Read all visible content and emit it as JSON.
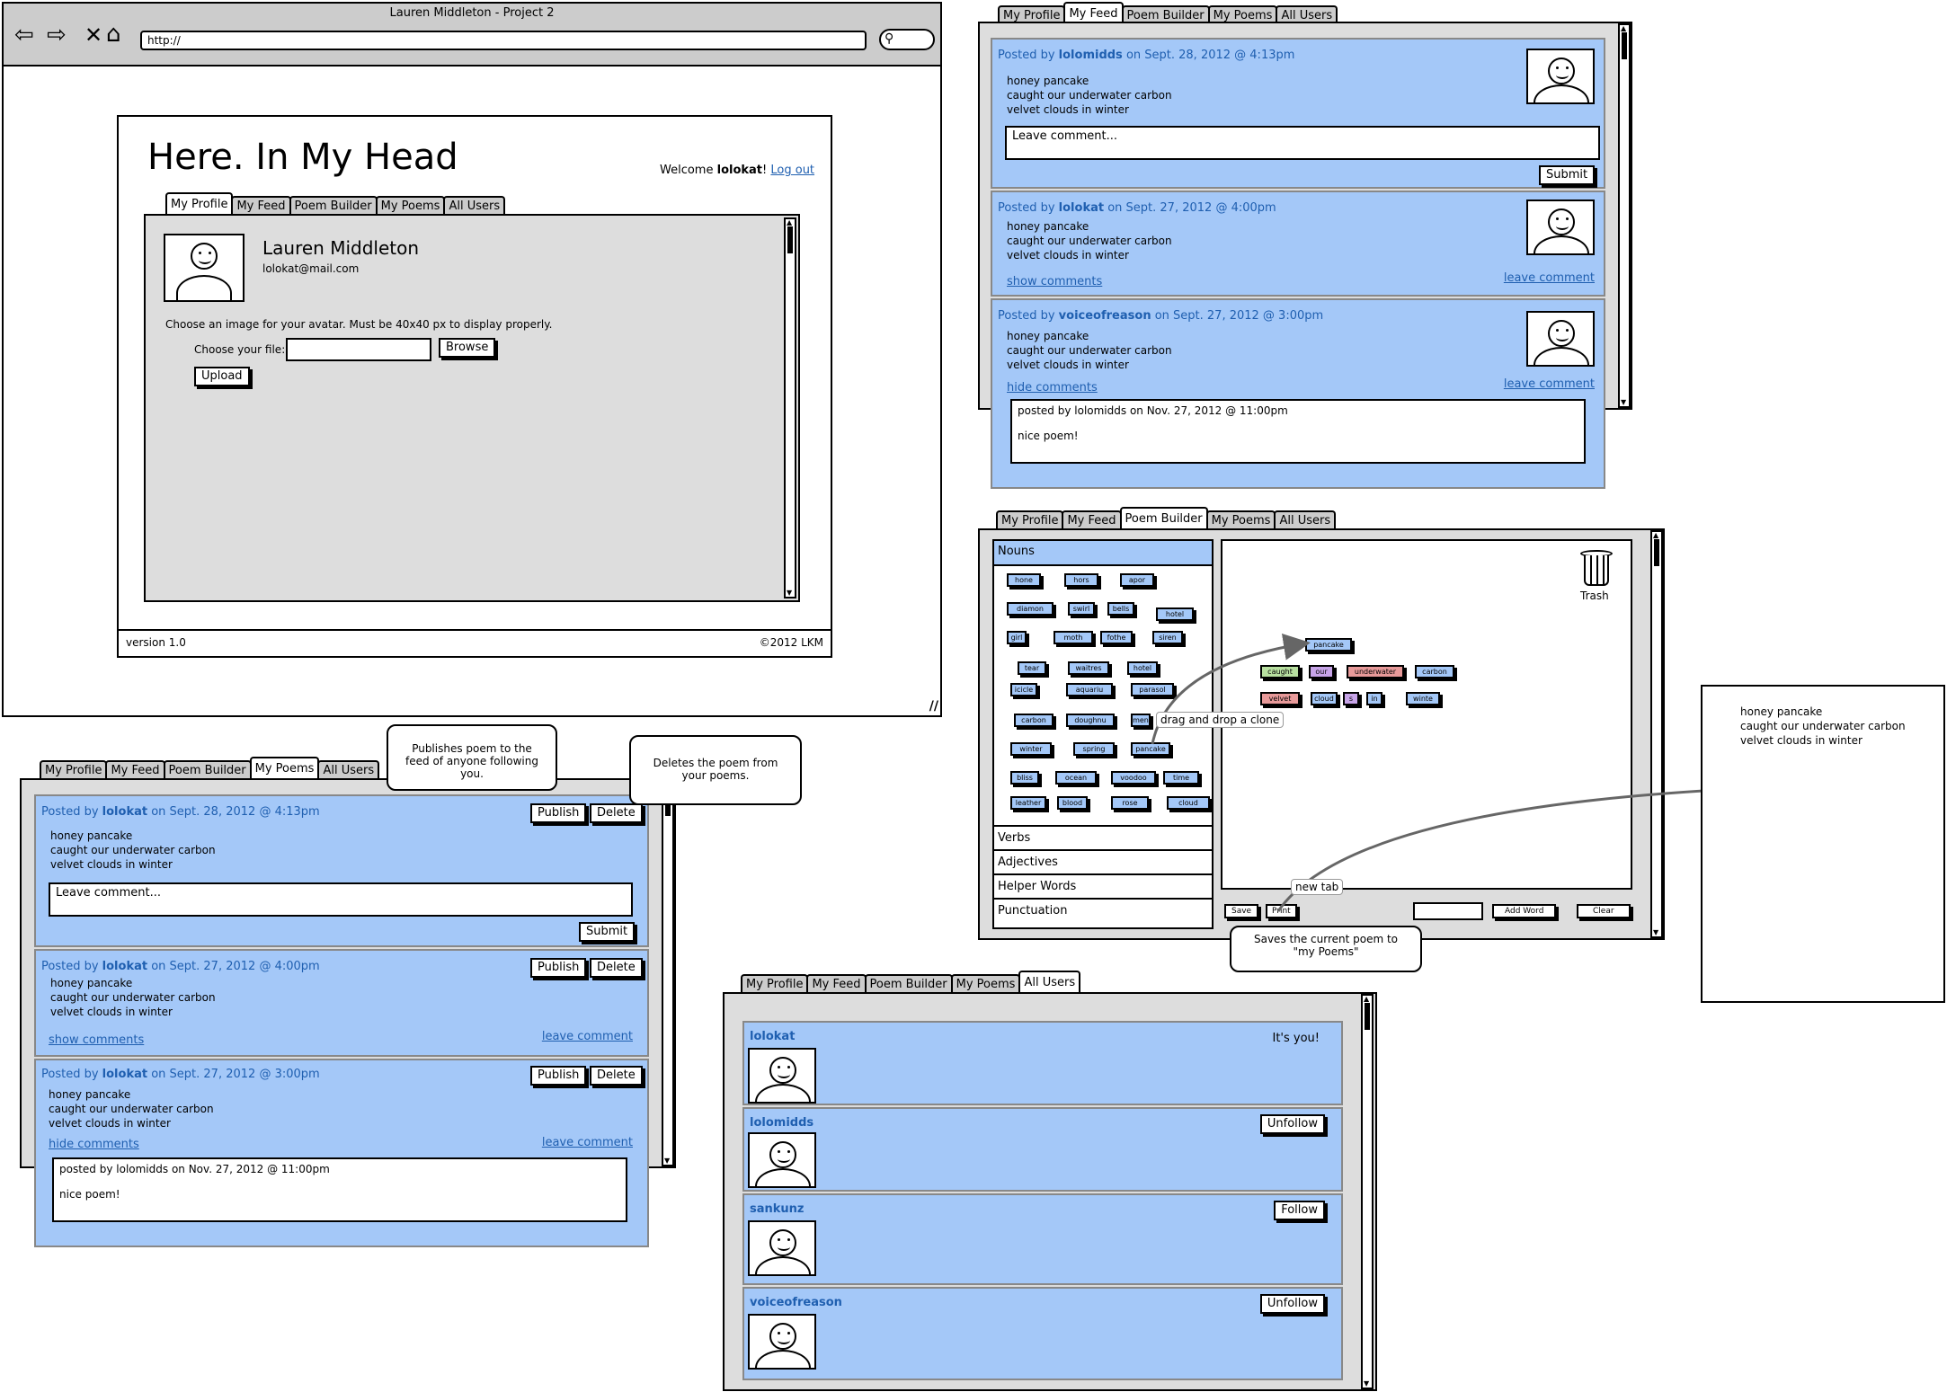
{
  "browser": {
    "title": "Lauren Middleton - Project 2",
    "url": "http://"
  },
  "profile": {
    "site_title": "Here. In My Head",
    "welcome_prefix": "Welcome ",
    "welcome_user": "lolokat",
    "welcome_suffix": "!",
    "logout_label": "Log out",
    "tabs": [
      "My Profile",
      "My Feed",
      "Poem Builder",
      "My Poems",
      "All Users"
    ],
    "name": "Lauren Middleton",
    "email": "lolokat@mail.com",
    "avatar_instructions": "Choose an image for your avatar. Must be 40x40 px to display properly.",
    "choose_file_label": "Choose your file:",
    "browse_label": "Browse",
    "upload_label": "Upload",
    "version": "version 1.0",
    "copyright": "©2012 LKM"
  },
  "poem_lines": [
    "honey pancake",
    "caught our underwater carbon",
    "velvet clouds in winter"
  ],
  "feed": {
    "tabs": [
      "My Profile",
      "My Feed",
      "Poem Builder",
      "My Poems",
      "All Users"
    ],
    "posts": [
      {
        "prefix": "Posted by ",
        "user": "lolomidds",
        "date": " on Sept. 28, 2012 @ 4:13pm"
      },
      {
        "prefix": "Posted by ",
        "user": "lolokat",
        "date": " on Sept. 27, 2012 @ 4:00pm"
      },
      {
        "prefix": "Posted by ",
        "user": "voiceofreason",
        "date": " on Sept. 27, 2012 @ 3:00pm"
      }
    ],
    "comment_placeholder": "Leave comment...",
    "submit_label": "Submit",
    "show_comments": "show comments",
    "hide_comments": "hide comments",
    "leave_comment": "leave comment",
    "comment_header": "posted by lolomidds on Nov. 27, 2012 @ 11:00pm",
    "comment_text": "nice poem!"
  },
  "mypoems": {
    "tabs": [
      "My Profile",
      "My Feed",
      "Poem Builder",
      "My Poems",
      "All Users"
    ],
    "posts": [
      {
        "prefix": "Posted by ",
        "user": "lolokat",
        "date": " on Sept. 28, 2012 @ 4:13pm"
      },
      {
        "prefix": "Posted by ",
        "user": "lolokat",
        "date": " on Sept. 27, 2012 @ 4:00pm"
      },
      {
        "prefix": "Posted by ",
        "user": "lolokat",
        "date": " on Sept. 27, 2012 @ 3:00pm"
      }
    ],
    "publish_label": "Publish",
    "delete_label": "Delete",
    "comment_placeholder": "Leave comment...",
    "submit_label": "Submit",
    "show_comments": "show comments",
    "hide_comments": "hide comments",
    "leave_comment": "leave comment",
    "comment_header": "posted by lolomidds on Nov. 27, 2012 @ 11:00pm",
    "comment_text": "nice poem!",
    "publish_callout": "Publishes poem to the feed of anyone following you.",
    "delete_callout": "Deletes the poem from your poems."
  },
  "builder": {
    "tabs": [
      "My Profile",
      "My Feed",
      "Poem Builder",
      "My Poems",
      "All Users"
    ],
    "categories": {
      "nouns": "Nouns",
      "verbs": "Verbs",
      "adjectives": "Adjectives",
      "helper": "Helper Words",
      "punct": "Punctuation"
    },
    "nouns": [
      "hone",
      "hors",
      "apor",
      "diamon",
      "swirl",
      "bells",
      "hotel",
      "girl",
      "moth",
      "fothe",
      "siren",
      "tear",
      "waitres",
      "hotel",
      "icicle",
      "aquariu",
      "parasol",
      "carbon",
      "doughnu",
      "men",
      "winter",
      "spring",
      "pancake",
      "bliss",
      "ocean",
      "voodoo",
      "time",
      "leather",
      "blood",
      "rose",
      "cloud"
    ],
    "canvas_words": [
      "pancake",
      "caught",
      "our",
      "underwater",
      "carbon",
      "velvet",
      "cloud",
      "s",
      "in",
      "winte"
    ],
    "trash_label": "Trash",
    "drag_label": "drag and drop a clone",
    "newtab_label": "new tab",
    "save_label": "Save",
    "print_label": "Print",
    "addword_label": "Add Word",
    "clear_label": "Clear",
    "save_callout": "Saves the current poem to \"my Poems\""
  },
  "print_page": {
    "lines": [
      "honey pancake",
      "caught our underwater carbon",
      "velvet clouds in winter"
    ]
  },
  "users": {
    "tabs": [
      "My Profile",
      "My Feed",
      "Poem Builder",
      "My Poems",
      "All Users"
    ],
    "list": [
      {
        "name": "lolokat",
        "action": "It's you!"
      },
      {
        "name": "lolomidds",
        "action": "Unfollow"
      },
      {
        "name": "sankunz",
        "action": "Follow"
      },
      {
        "name": "voiceofreason",
        "action": "Unfollow"
      }
    ]
  }
}
